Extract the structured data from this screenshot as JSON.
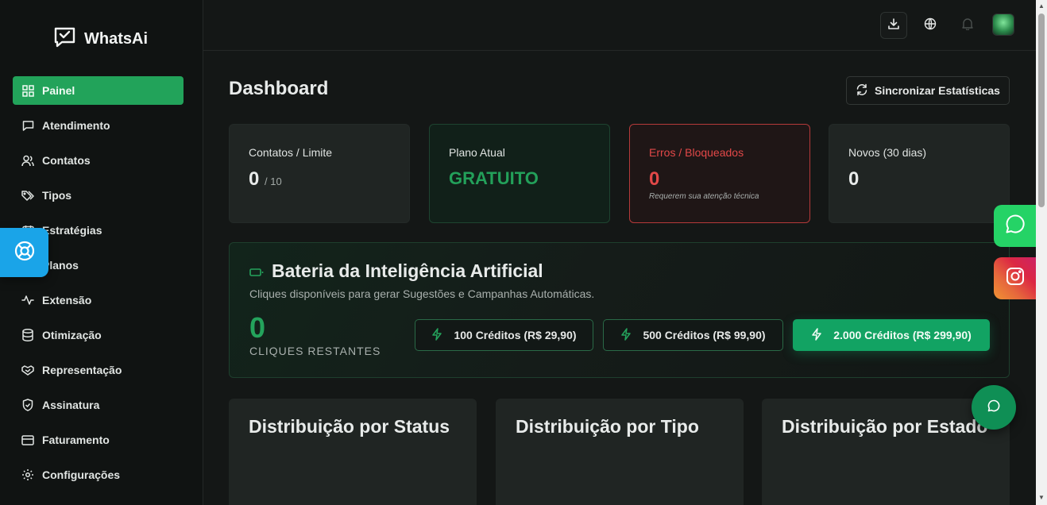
{
  "app": {
    "name": "WhatsAi"
  },
  "sidebar": {
    "items": [
      {
        "label": "Painel",
        "icon": "grid-icon"
      },
      {
        "label": "Atendimento",
        "icon": "message-icon"
      },
      {
        "label": "Contatos",
        "icon": "users-icon"
      },
      {
        "label": "Tipos",
        "icon": "tags-icon"
      },
      {
        "label": "Estratégias",
        "icon": "calendar-icon"
      },
      {
        "label": "Planos",
        "icon": "layers-icon"
      },
      {
        "label": "Extensão",
        "icon": "activity-icon"
      },
      {
        "label": "Otimização",
        "icon": "database-icon"
      },
      {
        "label": "Representação",
        "icon": "handshake-icon"
      },
      {
        "label": "Assinatura",
        "icon": "shield-icon"
      },
      {
        "label": "Faturamento",
        "icon": "credit-card-icon"
      },
      {
        "label": "Configurações",
        "icon": "gear-icon"
      }
    ]
  },
  "main": {
    "title": "Dashboard",
    "sync_label": "Sincronizar Estatísticas",
    "cards": {
      "contacts": {
        "label": "Contatos / Limite",
        "value": "0",
        "limit": "/ 10"
      },
      "plan": {
        "label": "Plano Atual",
        "value": "GRATUITO"
      },
      "errors": {
        "label": "Erros / Bloqueados",
        "value": "0",
        "note": "Requerem sua atenção técnica"
      },
      "new": {
        "label": "Novos (30 dias)",
        "value": "0"
      }
    },
    "battery": {
      "title": "Bateria da Inteligência Artificial",
      "subtitle": "Cliques disponíveis para gerar Sugestões e Campanhas Automáticas.",
      "count": "0",
      "count_label": "CLIQUES RESTANTES",
      "packs": [
        {
          "label": "100 Créditos (R$ 29,90)"
        },
        {
          "label": "500 Créditos (R$ 99,90)"
        },
        {
          "label": "2.000 Créditos (R$ 299,90)"
        }
      ]
    },
    "distributions": [
      {
        "title": "Distribuição por Status"
      },
      {
        "title": "Distribuição por Tipo"
      },
      {
        "title": "Distribuição por Estado"
      }
    ]
  },
  "colors": {
    "accent": "#22a35a",
    "danger": "#e24848",
    "background": "#141716"
  }
}
